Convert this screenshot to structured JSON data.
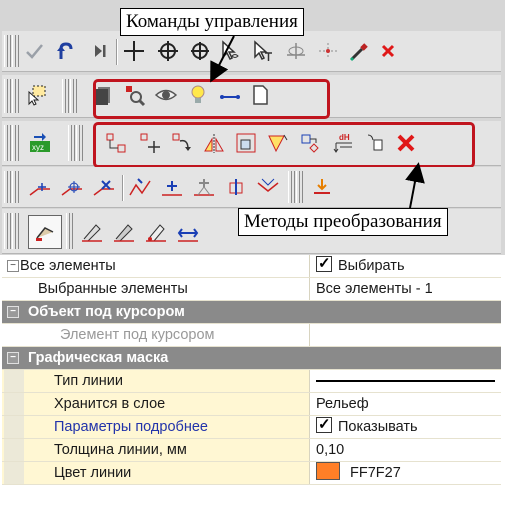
{
  "callouts": {
    "commands": "Команды управления",
    "methods": "Методы преобразования"
  },
  "colors": {
    "highlight": "#c0141e",
    "line_color_swatch": "#FF7F27"
  },
  "toolbar_icons": {
    "row1": [
      "checkmark-icon",
      "undo-icon",
      "next-step-icon",
      "crosshair-icon",
      "snap-target-icon",
      "snap-target2-icon",
      "select-pointer-icon",
      "select-pointer-t-icon",
      "grid-snap-icon",
      "node-snap-icon",
      "eyedropper-icon",
      "close-icon"
    ],
    "row2": [
      "select-frame-icon",
      "layer-icon",
      "find-element-icon",
      "view-eye-icon",
      "light-bulb-icon",
      "segment-icon",
      "blank-page-icon"
    ],
    "row3": [
      "xyz-coordinates-icon",
      "transform-1-icon",
      "move-icon",
      "rotate-icon",
      "mirror-icon",
      "scale-icon",
      "transform-6-icon",
      "transform-7-icon",
      "height-offset-icon",
      "transform-9-icon",
      "delete-icon"
    ],
    "row4": [
      "edit-1-icon",
      "edit-2-icon",
      "edit-3-icon",
      "edit-4-icon",
      "edit-5-icon",
      "edit-6-icon",
      "edit-7-icon",
      "edit-8-icon",
      "edit-9-icon"
    ],
    "row5": [
      "properties-icon",
      "draw-1-icon",
      "draw-2-icon",
      "draw-3-icon",
      "draw-4-icon"
    ]
  },
  "grid": {
    "rows": [
      {
        "type": "group",
        "name": "Все элементы",
        "value": "Выбирать",
        "checkbox": true
      },
      {
        "type": "item",
        "name": "Выбранные элементы",
        "value": "Все элементы - 1"
      },
      {
        "type": "category",
        "name": "Объект под курсором"
      },
      {
        "type": "disabled",
        "name": "Элемент под курсором",
        "value": ""
      },
      {
        "type": "category",
        "name": "Графическая маска"
      },
      {
        "type": "item",
        "name": "Тип линии",
        "value": ""
      },
      {
        "type": "item",
        "name": "Хранится в слое",
        "value": "Рельеф"
      },
      {
        "type": "link",
        "name": "Параметры подробнее",
        "value": "Показывать",
        "checkbox": true
      },
      {
        "type": "item",
        "name": "Толщина линии, мм",
        "value": "0,10"
      },
      {
        "type": "item",
        "name": "Цвет линии",
        "value": "FF7F27",
        "swatch": true
      }
    ]
  }
}
